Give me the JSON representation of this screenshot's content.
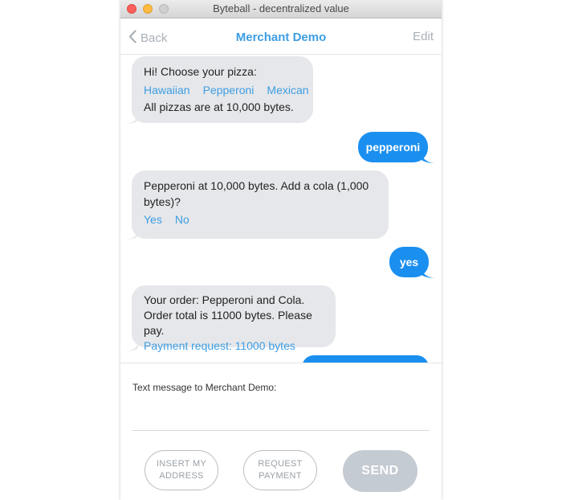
{
  "window": {
    "title": "Byteball - decentralized value"
  },
  "header": {
    "back_label": "Back",
    "title": "Merchant Demo",
    "edit_label": "Edit"
  },
  "messages": [
    {
      "from": "bot",
      "intro": "Hi! Choose your pizza:",
      "options": [
        "Hawaiian",
        "Pepperoni",
        "Mexican"
      ],
      "footer": "All pizzas are at 10,000 bytes."
    },
    {
      "from": "user",
      "text": "pepperoni"
    },
    {
      "from": "bot",
      "line1": "Pepperoni at 10,000 bytes. Add a cola (1,000",
      "line2": "bytes)?",
      "options": [
        "Yes",
        "No"
      ]
    },
    {
      "from": "user",
      "text": "yes"
    },
    {
      "from": "bot",
      "line1": "Your order: Pepperoni and Cola.",
      "line2": "Order total is 11000 bytes. Please pay.",
      "link": "Payment request: 11000 bytes"
    }
  ],
  "composer": {
    "label": "Text message to Merchant Demo:",
    "insert_address_label": "INSERT MY ADDRESS",
    "request_payment_label": "REQUEST PAYMENT",
    "send_label": "SEND"
  },
  "colors": {
    "accent": "#3d9ee3",
    "user_bubble": "#1a8ff0",
    "bot_bubble": "#e6e7ea",
    "send_disabled": "#c5cbd3"
  }
}
